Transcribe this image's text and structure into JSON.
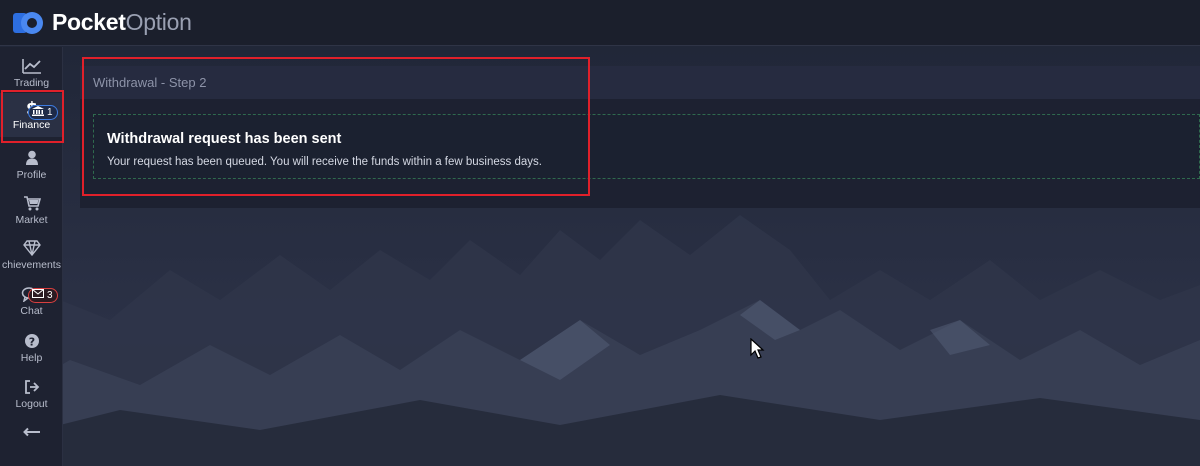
{
  "brand": {
    "name_bold": "Pocket",
    "name_light": "Option",
    "accent_color": "#2d6ee0"
  },
  "sidebar": {
    "items": [
      {
        "label": "Trading",
        "icon": "chart-line-icon"
      },
      {
        "label": "Finance",
        "icon": "dollar-icon",
        "badge": "1",
        "badge_icon": "bank-icon",
        "active": true
      },
      {
        "label": "Profile",
        "icon": "user-icon"
      },
      {
        "label": "Market",
        "icon": "cart-icon"
      },
      {
        "label": "chievements",
        "icon": "diamond-icon"
      },
      {
        "label": "Chat",
        "icon": "chat-icon",
        "badge": "3",
        "badge_icon": "envelope-icon"
      },
      {
        "label": "Help",
        "icon": "question-icon"
      },
      {
        "label": "Logout",
        "icon": "logout-icon"
      }
    ],
    "collapse_icon": "arrow-left-icon"
  },
  "panel": {
    "title": "Withdrawal - Step 2",
    "success_title": "Withdrawal request has been sent",
    "success_text": "Your request has been queued. You will receive the funds within a few business days."
  },
  "colors": {
    "highlight": "#e0202a",
    "success_border": "#2f6a4e",
    "badge_blue": "#3d7be0",
    "badge_red": "#d94040"
  }
}
